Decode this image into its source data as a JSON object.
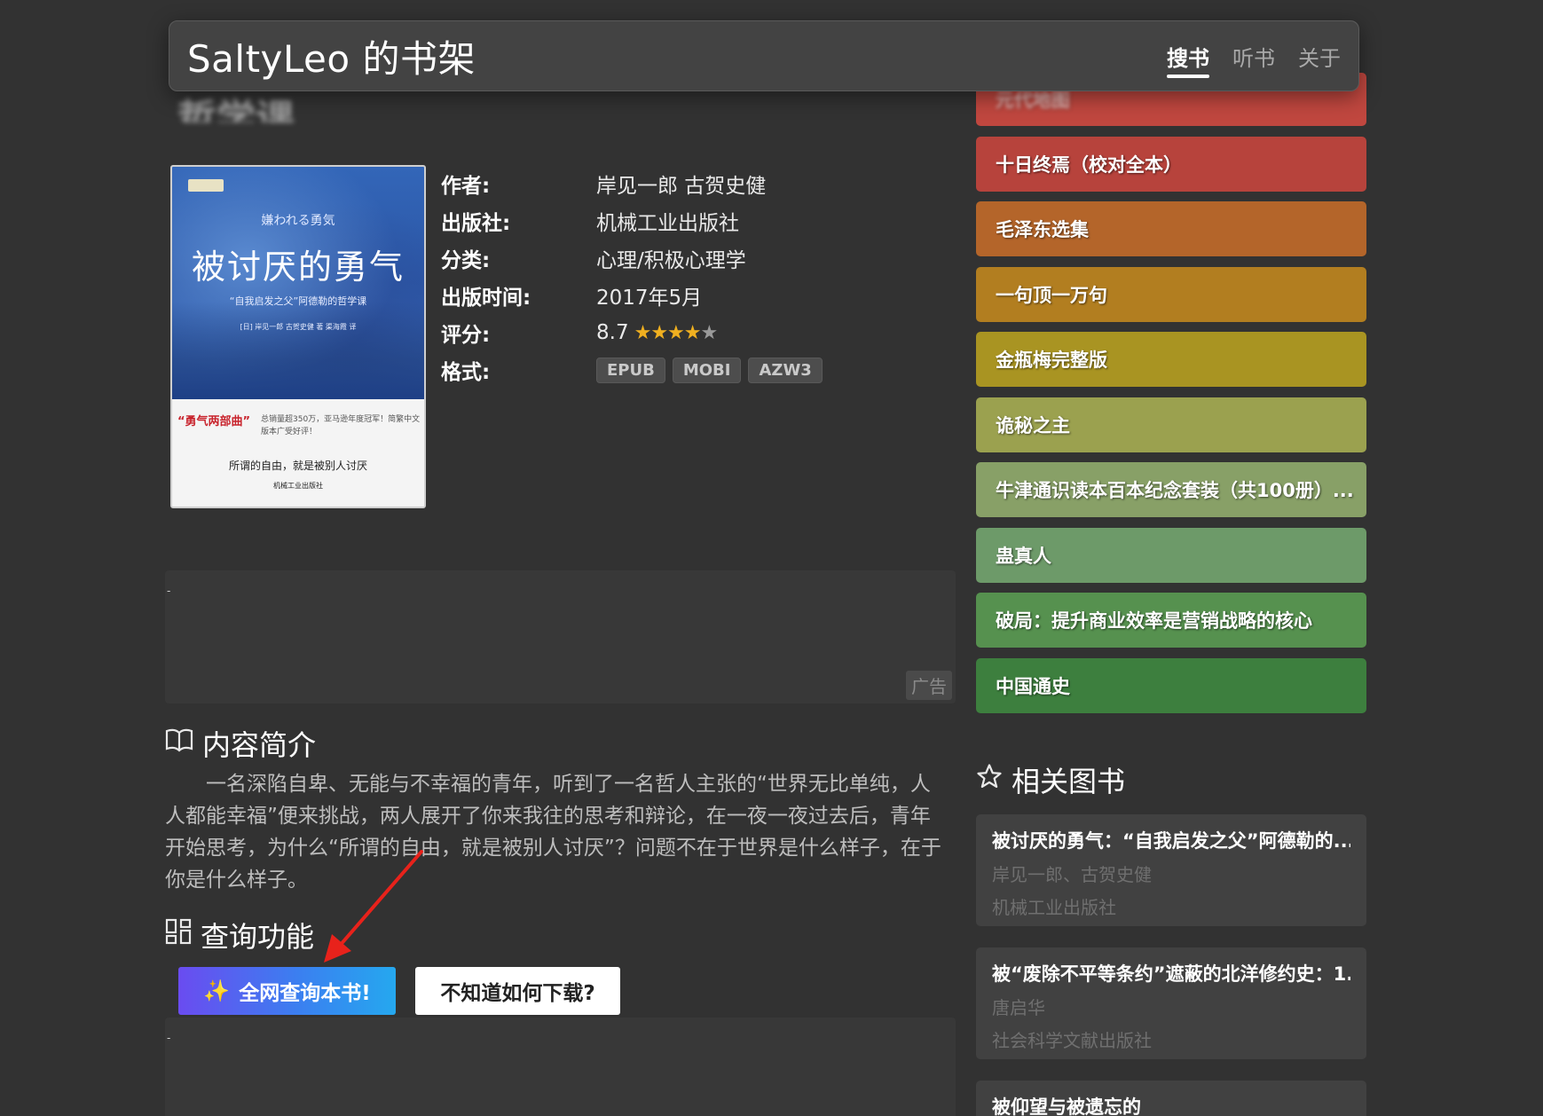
{
  "header": {
    "brand": "SaltyLeo 的书架",
    "nav": [
      {
        "label": "搜书",
        "active": true
      },
      {
        "label": "听书",
        "active": false
      },
      {
        "label": "关于",
        "active": false
      }
    ]
  },
  "book": {
    "ghost_title": "哲学课",
    "cover": {
      "jp_title": "嫌われる勇気",
      "title": "被讨厌的勇气",
      "subtitle": "“自我启发之父”阿德勒的哲学课",
      "authors_line": "[日] 岸见一郎 古贺史健 著 渠海霞 译",
      "series": "“勇气两部曲”",
      "promo": "总销量超350万，亚马逊年度冠军！简繁中文版本广受好评！",
      "tagline": "所谓的自由，就是被别人讨厌",
      "publisher": "机械工业出版社"
    },
    "labels": {
      "author": "作者:",
      "publisher": "出版社:",
      "category": "分类:",
      "date": "出版时间:",
      "rating": "评分:",
      "format": "格式:"
    },
    "author": "岸见一郎 古贺史健",
    "publisher": "机械工业出版社",
    "category": "心理/积极心理学",
    "date": "2017年5月",
    "rating": "8.7",
    "stars": {
      "filled": 4,
      "total": 5
    },
    "formats": [
      "EPUB",
      "MOBI",
      "AZW3"
    ]
  },
  "ad": {
    "label": "广告",
    "dash": "-"
  },
  "intro": {
    "title": "内容简介",
    "text": "一名深陷自卑、无能与不幸福的青年，听到了一名哲人主张的“世界无比单纯，人人都能幸福”便来挑战，两人展开了你来我往的思考和辩论，在一夜一夜过去后，青年开始思考，为什么“所谓的自由，就是被别人讨厌”？问题不在于世界是什么样子，在于你是什么样子。"
  },
  "query": {
    "title": "查询功能",
    "primary_btn": "全网查询本书!",
    "secondary_btn": "不知道如何下载?"
  },
  "ranking": [
    {
      "label": "元代地图",
      "color": "#c0473f"
    },
    {
      "label": "十日终焉（校对全本）",
      "color": "#b7433c"
    },
    {
      "label": "毛泽东选集",
      "color": "#b4652a"
    },
    {
      "label": "一句顶一万句",
      "color": "#b27e20"
    },
    {
      "label": "金瓶梅完整版",
      "color": "#a99422"
    },
    {
      "label": "诡秘之主",
      "color": "#9ba14f"
    },
    {
      "label": "牛津通识读本百本纪念套装（共100册）...",
      "color": "#88a067"
    },
    {
      "label": "蛊真人",
      "color": "#6d9a69"
    },
    {
      "label": "破局：提升商业效率是营销战略的核心",
      "color": "#56914f"
    },
    {
      "label": "中国通史",
      "color": "#3d7f3e"
    }
  ],
  "related": {
    "title": "相关图书",
    "items": [
      {
        "title": "被讨厌的勇气：“自我启发之父”阿德勒的...",
        "author": "岸见一郎、古贺史健",
        "publisher": "机械工业出版社"
      },
      {
        "title": "被“废除不平等条约”遮蔽的北洋修约史：1...",
        "author": "唐启华",
        "publisher": "社会科学文献出版社"
      },
      {
        "title": "被仰望与被遗忘的",
        "author": "",
        "publisher": ""
      }
    ]
  }
}
